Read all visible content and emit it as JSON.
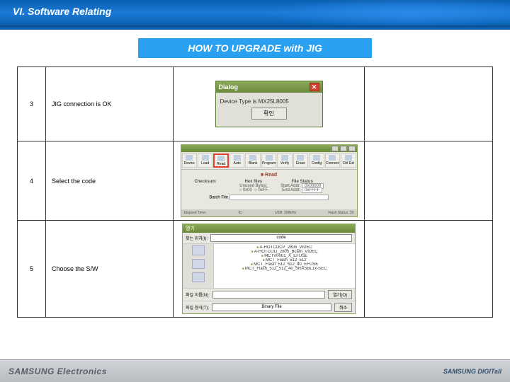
{
  "header": {
    "title": "VI. Software Relating"
  },
  "ribbon": "HOW TO UPGRADE with JIG",
  "rows": [
    {
      "num": "3",
      "desc": "JIG connection is OK"
    },
    {
      "num": "4",
      "desc": "Select the code"
    },
    {
      "num": "5",
      "desc": "Choose the S/W"
    }
  ],
  "dialog": {
    "title": "Dialog",
    "msg": "Device Type is MX25L8005",
    "btn": "확인"
  },
  "app": {
    "toolbar": [
      "Device",
      "Load",
      "Read",
      "Auto",
      "Blank",
      "Program",
      "Verify",
      "Erase",
      "Config",
      "Connect",
      "Ctrl Ext"
    ],
    "readTab": "Read",
    "checksum": "Checksum",
    "hexLbl": "Hex files",
    "unusedLbl": "Unused Bytes:",
    "opt1": "0x00",
    "opt2": "0xFF",
    "fileStatus": "File Status",
    "startLbl": "Start Addr:",
    "startVal": "0x00000",
    "endLbl": "End Addr:",
    "endVal": "0xFFFF",
    "batchLbl": "Batch File",
    "statElapsed": "Elapsed Time:",
    "statIC": "IC:",
    "statUSB": "USB: 398kHz",
    "statFlash": "Flash Status: 00"
  },
  "filedlg": {
    "title": "열기",
    "locLbl": "찾는 위치(I):",
    "loc": "code",
    "files": [
      "A-HOTCOCP_2806_VIDEC",
      "A-HOTCOLI_2805_Bcam_VIDEC",
      "MCTV0001_X_EFUSE",
      "MCT_Flash_512_512",
      "MCT_Flash_512_512_40_EFUSE",
      "MCT_Flash_512_512_40_SRASBL1x-SEC"
    ],
    "nameLbl": "파일 이름(N):",
    "typeLbl": "파일 형식(T):",
    "typeVal": "Binary File",
    "openBtn": "열기(O)",
    "cancelBtn": "취소"
  },
  "footer": {
    "left": "SAMSUNG Electronics",
    "right": "SAMSUNG DIGITall"
  }
}
